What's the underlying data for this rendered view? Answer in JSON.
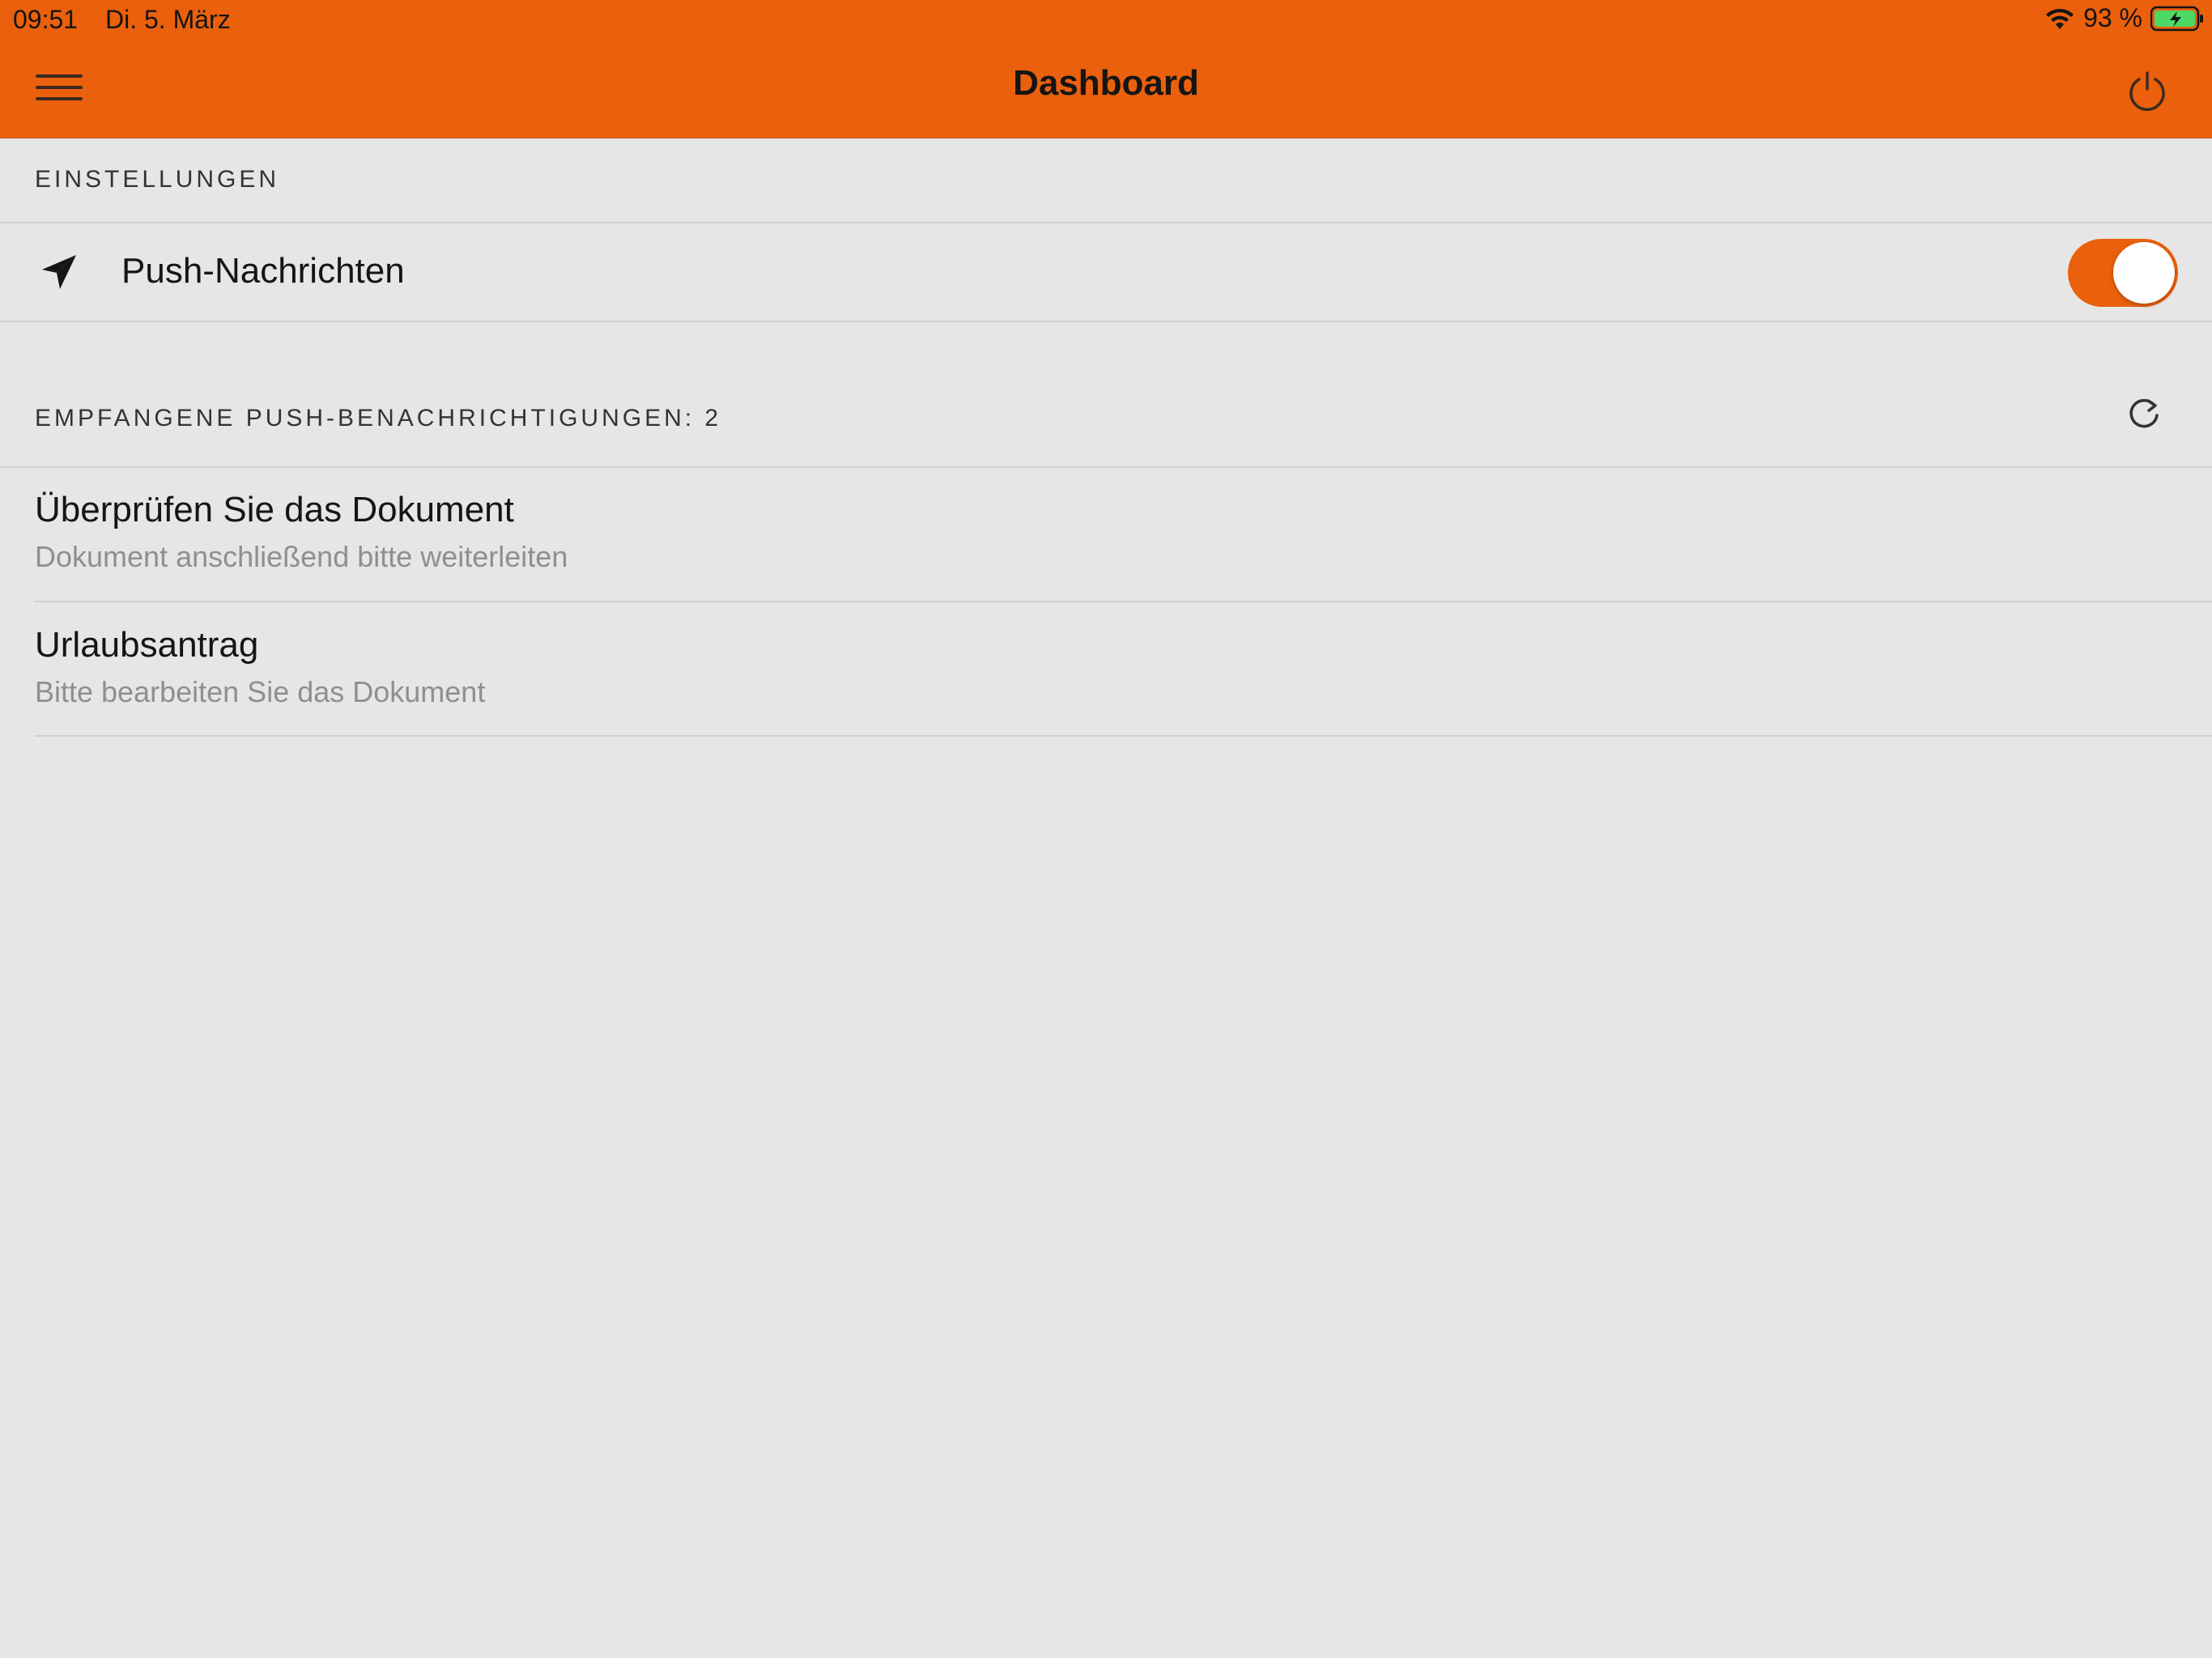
{
  "status_bar": {
    "time": "09:51",
    "date": "Di. 5. März",
    "battery": "93 %",
    "wifi_icon": "wifi-icon",
    "battery_icon": "battery-charging-icon"
  },
  "header": {
    "title": "Dashboard",
    "menu_icon": "hamburger-menu-icon",
    "power_icon": "power-icon",
    "background_color": "#ea600c"
  },
  "settings": {
    "section_title": "EINSTELLUNGEN",
    "push": {
      "label": "Push-Nachrichten",
      "icon": "paper-plane-icon",
      "enabled": true
    }
  },
  "notifications": {
    "section_title": "EMPFANGENE PUSH-BENACHRICHTIGUNGEN: 2",
    "refresh_icon": "refresh-icon",
    "items": [
      {
        "title": "Überprüfen Sie das Dokument",
        "subtitle": "Dokument anschließend bitte weiterleiten"
      },
      {
        "title": "Urlaubsantrag",
        "subtitle": "Bitte bearbeiten Sie das Dokument"
      }
    ]
  }
}
